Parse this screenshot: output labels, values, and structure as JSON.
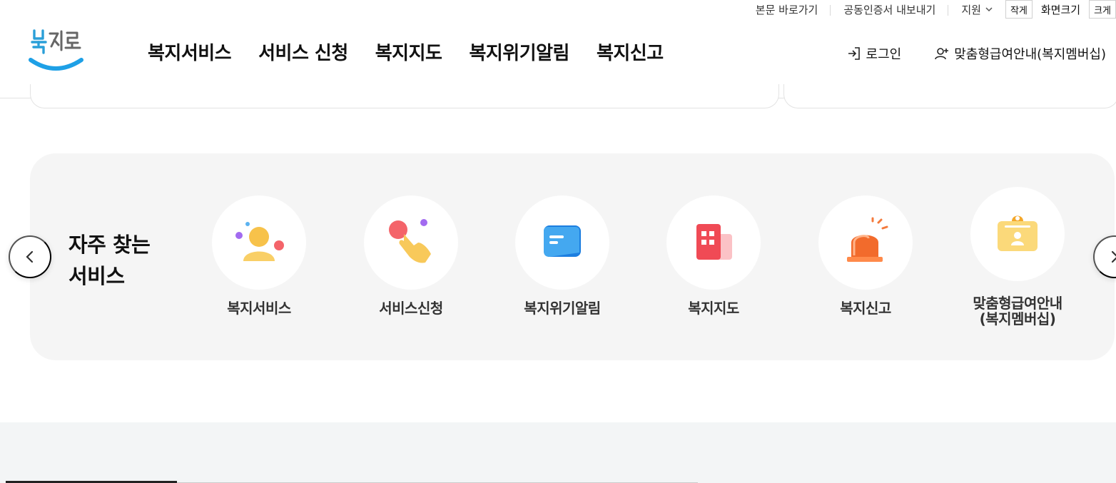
{
  "utility": {
    "skip_to_content": "본문 바로가기",
    "export_certificate": "공동인증서 내보내기",
    "support": "지원",
    "smaller": "작게",
    "screen_size": "화면크기",
    "larger": "크게"
  },
  "header": {
    "logo_text": "복지로",
    "nav": [
      "복지서비스",
      "서비스 신청",
      "복지지도",
      "복지위기알림",
      "복지신고"
    ],
    "login": "로그인",
    "membership": "맞춤형급여안내(복지멤버십)"
  },
  "quick": {
    "title_line1": "자주 찾는",
    "title_line2": "서비스",
    "items": [
      {
        "label": "복지서비스",
        "icon": "person-icon"
      },
      {
        "label": "서비스신청",
        "icon": "hand-pointer-icon"
      },
      {
        "label": "복지위기알림",
        "icon": "message-card-icon"
      },
      {
        "label": "복지지도",
        "icon": "building-icon"
      },
      {
        "label": "복지신고",
        "icon": "siren-icon"
      },
      {
        "label_line1": "맞춤형급여안내",
        "label_line2": "(복지멤버십)",
        "icon": "id-badge-icon"
      }
    ]
  },
  "colors": {
    "brand_blue": "#1ea0e6",
    "panel_bg": "#f5f5f5",
    "bottom_bg": "#f3f5f6"
  }
}
